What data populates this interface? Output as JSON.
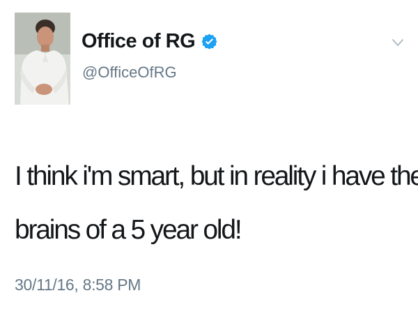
{
  "tweet": {
    "author": {
      "display_name": "Office of RG",
      "handle": "@OfficeOfRG",
      "verified": true,
      "avatar_icon": "profile-photo",
      "verified_icon": "verified-badge-icon",
      "verified_color": "#1da1f2"
    },
    "menu_icon": "chevron-down-icon",
    "text_lines": [
      "I think i'm smart, but in reality i have the",
      "brains of a 5 year old!"
    ],
    "timestamp": "30/11/16, 8:58 PM"
  },
  "colors": {
    "primary_text": "#14171a",
    "secondary_text": "#657786",
    "background": "#ffffff"
  }
}
